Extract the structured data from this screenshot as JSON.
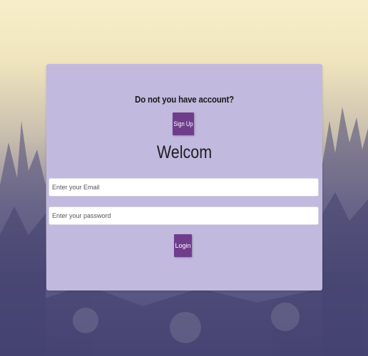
{
  "signup_section": {
    "prompt": "Do not you have account?",
    "signup_label": "Sign Up"
  },
  "login_form": {
    "title": "Welcom",
    "email_placeholder": "Enter your Email",
    "password_placeholder": "Enter your password",
    "login_label": "Login"
  },
  "colors": {
    "card_background": "#c2b9df",
    "button_background": "#6f3d8b",
    "button_text": "#ffffff"
  }
}
